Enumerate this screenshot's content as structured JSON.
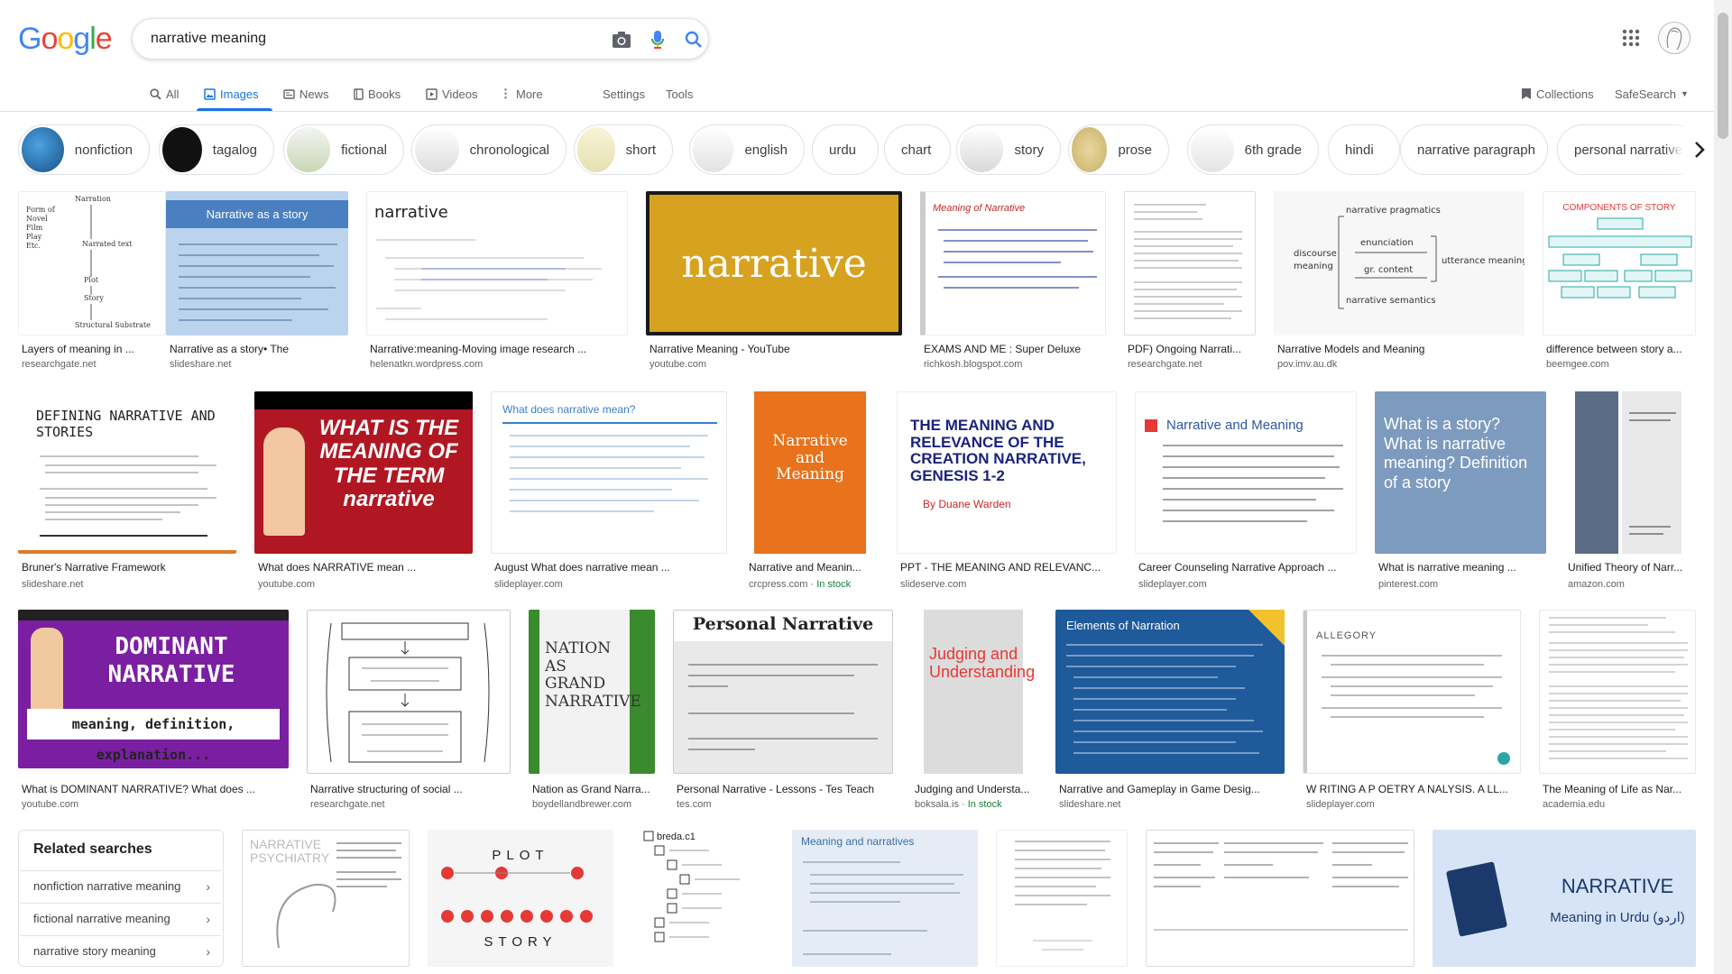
{
  "logo": {
    "letters": [
      "G",
      "o",
      "o",
      "g",
      "l",
      "e"
    ],
    "colors": [
      "#4285F4",
      "#EA4335",
      "#FBBC05",
      "#4285F4",
      "#34A853",
      "#EA4335"
    ]
  },
  "search": {
    "query": "narrative meaning",
    "placeholder": ""
  },
  "nav": {
    "tabs": [
      {
        "label": "All",
        "icon": "search-icon"
      },
      {
        "label": "Images",
        "icon": "image-icon"
      },
      {
        "label": "News",
        "icon": "news-icon"
      },
      {
        "label": "Books",
        "icon": "book-icon"
      },
      {
        "label": "Videos",
        "icon": "video-icon"
      },
      {
        "label": "More",
        "icon": "more-vert-icon"
      }
    ],
    "settings": "Settings",
    "tools": "Tools",
    "collections": "Collections",
    "safesearch": "SafeSearch"
  },
  "chips": [
    {
      "label": "nonfiction"
    },
    {
      "label": "tagalog"
    },
    {
      "label": "fictional"
    },
    {
      "label": "chronological"
    },
    {
      "label": "short"
    },
    {
      "label": "english"
    },
    {
      "label": "urdu"
    },
    {
      "label": "chart"
    },
    {
      "label": "story"
    },
    {
      "label": "prose"
    },
    {
      "label": "6th grade"
    },
    {
      "label": "hindi"
    },
    {
      "label": "narrative paragraph"
    },
    {
      "label": "personal narrative"
    }
  ],
  "results": [
    {
      "title": "Layers of meaning in ...",
      "source": "researchgate.net"
    },
    {
      "title": "Narrative as a story• The",
      "source": "slideshare.net",
      "img_title": "Narrative as a story"
    },
    {
      "title": "Narrative:meaning-Moving image research ...",
      "source": "helenatkn.wordpress.com",
      "img_title": "narrative"
    },
    {
      "title": "Narrative Meaning - YouTube",
      "source": "youtube.com",
      "img_title": "narrative"
    },
    {
      "title": "EXAMS AND ME : Super Deluxe",
      "source": "richkosh.blogspot.com",
      "img_title": "Meaning of Narrative"
    },
    {
      "title": "PDF) Ongoing Narrati...",
      "source": "researchgate.net"
    },
    {
      "title": "Narrative Models and Meaning",
      "source": "pov.imv.au.dk"
    },
    {
      "title": "difference between story a...",
      "source": "beemgee.com",
      "img_title": "COMPONENTS OF STORY"
    },
    {
      "title": "Bruner's Narrative Framework",
      "source": "slideshare.net",
      "img_title": "DEFINING NARRATIVE AND STORIES"
    },
    {
      "title": "What does NARRATIVE mean ...",
      "source": "youtube.com",
      "img_title": "WHAT IS THE MEANING OF THE TERM narrative"
    },
    {
      "title": "August What does narrative mean ...",
      "source": "slideplayer.com",
      "img_title": "What does narrative mean?"
    },
    {
      "title": "Narrative and Meanin...",
      "source": "crcpress.com",
      "stock": "In stock",
      "img_title": "Narrative and Meaning"
    },
    {
      "title": "PPT - THE MEANING AND RELEVANC...",
      "source": "slideserve.com",
      "img_title": "THE MEANING AND RELEVANCE OF THE CREATION NARRATIVE, GENESIS 1-2",
      "img_sub": "By Duane Warden"
    },
    {
      "title": "Career Counseling Narrative Approach ...",
      "source": "slideplayer.com",
      "img_title": "Narrative and Meaning"
    },
    {
      "title": "What is narrative meaning ...",
      "source": "pinterest.com",
      "img_title": "What is a story? What is narrative meaning? Definition of a story"
    },
    {
      "title": "Unified Theory of Narr...",
      "source": "amazon.com"
    },
    {
      "title": "What is DOMINANT NARRATIVE? What does ...",
      "source": "youtube.com",
      "img_title": "DOMINANT NARRATIVE",
      "img_sub": "meaning, definition, explanation..."
    },
    {
      "title": "Narrative structuring of social ...",
      "source": "researchgate.net"
    },
    {
      "title": "Nation as Grand Narra...",
      "source": "boydellandbrewer.com",
      "img_title": "NATION AS GRAND NARRATIVE"
    },
    {
      "title": "Personal Narrative - Lessons - Tes Teach",
      "source": "tes.com",
      "img_title": "Personal Narrative"
    },
    {
      "title": "Judging and Understa...",
      "source": "boksala.is",
      "stock": "In stock",
      "img_title": "Judging and Understanding"
    },
    {
      "title": "Narrative and Gameplay in Game Desig...",
      "source": "slideshare.net",
      "img_title": "Elements of Narration"
    },
    {
      "title": "W RITING A P OETRY A NALYSIS. A LL...",
      "source": "slideplayer.com",
      "img_title": "ALLEGORY"
    },
    {
      "title": "The Meaning of Life as Nar...",
      "source": "academia.edu"
    }
  ],
  "bottom_row": [
    {
      "img_title": "NARRATIVE PSYCHIATRY"
    },
    {
      "img_title": "PLOT",
      "img_sub": "STORY"
    },
    {
      "img_title": "breda.c1"
    },
    {
      "img_title": "Meaning and narratives"
    },
    {
      "img_title": ""
    },
    {
      "img_title": ""
    },
    {
      "img_title": "NARRATIVE",
      "img_sub": "Meaning in Urdu (اردو)"
    }
  ],
  "related": {
    "heading": "Related searches",
    "items": [
      "nonfiction narrative meaning",
      "fictional narrative meaning",
      "narrative story meaning"
    ]
  }
}
